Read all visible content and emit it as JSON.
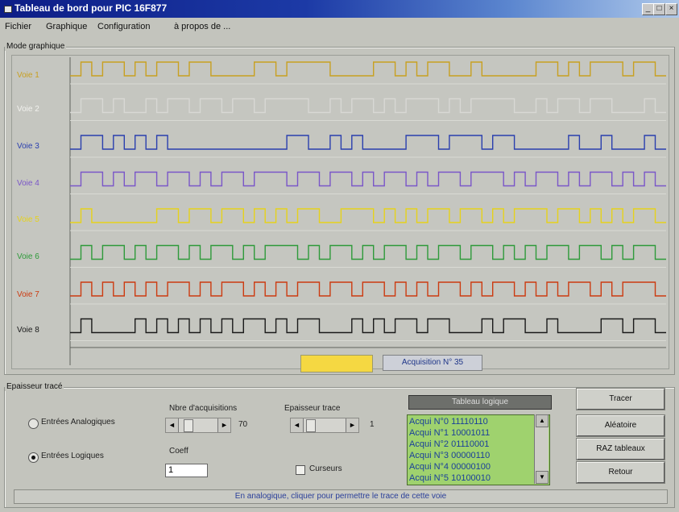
{
  "window": {
    "title": "Tableau de bord pour PIC 16F877",
    "controls": [
      "minimize-icon",
      "maximize-icon",
      "close-icon"
    ],
    "accent": "#1c3aa6"
  },
  "menu": [
    "Fichier",
    "Graphique",
    "Configuration",
    "à propos de ..."
  ],
  "graph_group": {
    "label": "Mode graphique",
    "channels": [
      {
        "label": "Voie 1",
        "color": "#c8a020",
        "bits": "0101101011011000011011110000110101100100000110101110110"
      },
      {
        "label": "Voie 2",
        "color": "#d8d8d4",
        "bits": "0110100101101101101111001011010111010111100101101100010"
      },
      {
        "label": "Voie 3",
        "color": "#2a3fae",
        "bits": "0110101010000000000011001010000111011101100000100100010"
      },
      {
        "label": "Voie 4",
        "color": "#7a56c8",
        "bits": "0110101101101011011101101101011010110111010110101101010"
      },
      {
        "label": "Voie 5",
        "color": "#e6d21a",
        "bits": "0100000011011011010101100111010101101101011101101010110"
      },
      {
        "label": "Voie 6",
        "color": "#2e9a3a",
        "bits": "0101101011010110101110101101011010110110101011011010110"
      },
      {
        "label": "Voie 7",
        "color": "#cc3a10",
        "bits": "0101010101101011010101101101101010110101101010110101110"
      },
      {
        "label": "Voie 8",
        "color": "#1a1a1a",
        "bits": "0100001010101010110101100010101101100010110010000110110"
      }
    ],
    "highlight_color": "#f5d842",
    "acquisition_label": "Acquisition N° 35"
  },
  "lower_group": {
    "label": "Epaisseur tracé",
    "radio_analog": "Entrées Analogiques",
    "radio_logic": "Entrées Logiques",
    "nbre_label": "Nbre d'acquisitions",
    "nbre_value": "70",
    "epaisseur_label": "Epaisseur trace",
    "epaisseur_value": "1",
    "coeff_label": "Coeff",
    "coeff_value": "1",
    "curseurs_label": "Curseurs",
    "tableau_header": "Tableau logique",
    "tableau_rows": [
      "Acqui N°0 11110110",
      "Acqui N°1 10001011",
      "Acqui N°2 01110001",
      "Acqui N°3 00000110",
      "Acqui N°4 00000100",
      "Acqui N°5 10100010"
    ],
    "buttons": [
      "Tracer",
      "Aléatoire",
      "RAZ tableaux",
      "Retour"
    ]
  },
  "status_text": "En analogique, cliquer pour permettre le trace de cette voie"
}
